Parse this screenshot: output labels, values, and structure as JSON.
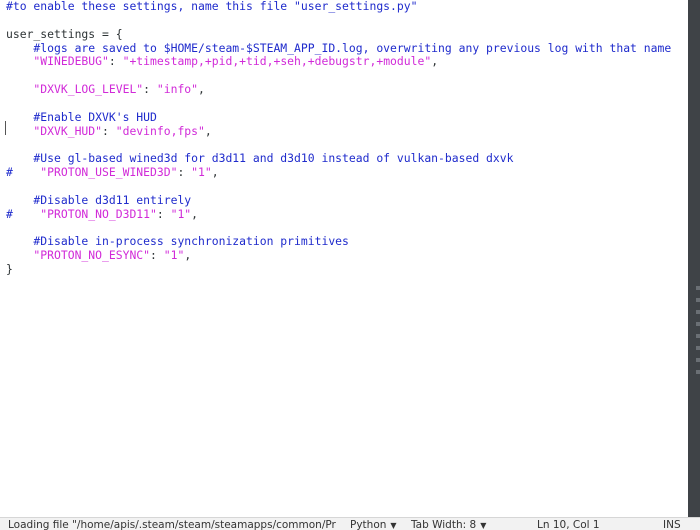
{
  "editor": {
    "lines": [
      {
        "segments": [
          {
            "text": "#to enable these settings, name this file \"user_settings.py\"",
            "kind": "comment"
          }
        ]
      },
      {
        "segments": []
      },
      {
        "segments": [
          {
            "text": "user_settings = {",
            "kind": "plain"
          }
        ]
      },
      {
        "segments": [
          {
            "text": "    #logs are saved to $HOME/steam-$STEAM_APP_ID.log, overwriting any previous log with that name",
            "kind": "comment"
          }
        ]
      },
      {
        "segments": [
          {
            "text": "    \"WINEDEBUG\"",
            "kind": "string"
          },
          {
            "text": ": ",
            "kind": "plain"
          },
          {
            "text": "\"+timestamp,+pid,+tid,+seh,+debugstr,+module\"",
            "kind": "string"
          },
          {
            "text": ",",
            "kind": "plain"
          }
        ]
      },
      {
        "segments": []
      },
      {
        "segments": [
          {
            "text": "    \"DXVK_LOG_LEVEL\"",
            "kind": "string"
          },
          {
            "text": ": ",
            "kind": "plain"
          },
          {
            "text": "\"info\"",
            "kind": "string"
          },
          {
            "text": ",",
            "kind": "plain"
          }
        ]
      },
      {
        "segments": []
      },
      {
        "segments": [
          {
            "text": "    #Enable DXVK's HUD",
            "kind": "comment"
          }
        ]
      },
      {
        "segments": [
          {
            "text": "    \"DXVK_HUD\"",
            "kind": "string"
          },
          {
            "text": ": ",
            "kind": "plain"
          },
          {
            "text": "\"devinfo,fps\"",
            "kind": "string"
          },
          {
            "text": ",",
            "kind": "plain"
          }
        ]
      },
      {
        "segments": []
      },
      {
        "segments": [
          {
            "text": "    #Use gl-based wined3d for d3d11 and d3d10 instead of vulkan-based dxvk",
            "kind": "comment"
          }
        ]
      },
      {
        "segments": [
          {
            "text": "#",
            "kind": "comment"
          },
          {
            "text": "    \"PROTON_USE_WINED3D\"",
            "kind": "string"
          },
          {
            "text": ": ",
            "kind": "plain"
          },
          {
            "text": "\"1\"",
            "kind": "string"
          },
          {
            "text": ",",
            "kind": "plain"
          }
        ]
      },
      {
        "segments": []
      },
      {
        "segments": [
          {
            "text": "    #Disable d3d11 entirely",
            "kind": "comment"
          }
        ]
      },
      {
        "segments": [
          {
            "text": "#",
            "kind": "comment"
          },
          {
            "text": "    \"PROTON_NO_D3D11\"",
            "kind": "string"
          },
          {
            "text": ": ",
            "kind": "plain"
          },
          {
            "text": "\"1\"",
            "kind": "string"
          },
          {
            "text": ",",
            "kind": "plain"
          }
        ]
      },
      {
        "segments": []
      },
      {
        "segments": [
          {
            "text": "    #Disable in-process synchronization primitives",
            "kind": "comment"
          }
        ]
      },
      {
        "segments": [
          {
            "text": "    \"PROTON_NO_ESYNC\"",
            "kind": "string"
          },
          {
            "text": ": ",
            "kind": "plain"
          },
          {
            "text": "\"1\"",
            "kind": "string"
          },
          {
            "text": ",",
            "kind": "plain"
          }
        ]
      },
      {
        "segments": [
          {
            "text": "}",
            "kind": "plain"
          }
        ]
      }
    ]
  },
  "statusbar": {
    "message": "Loading file \"/home/apis/.steam/steam/steamapps/common/Pr",
    "language": "Python",
    "tab_width": "Tab Width: 8",
    "cursor_position": "Ln 10, Col 1",
    "mode": "INS"
  },
  "colors": {
    "comment": "#1f2bcc",
    "string": "#d12ad8",
    "plain": "#2e3436",
    "background": "#ffffff",
    "side_strip": "#3f4347"
  },
  "icons": {
    "dropdown": "chevron-down-icon"
  }
}
